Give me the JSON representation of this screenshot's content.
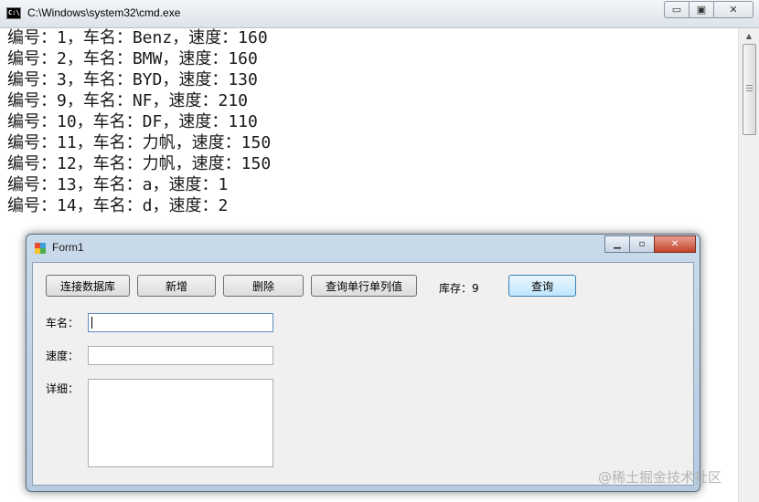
{
  "cmd": {
    "title": "C:\\Windows\\system32\\cmd.exe",
    "icon_text": "C:\\",
    "lines": [
      "编号：1，车名：Benz，速度：160",
      "编号：2，车名：BMW，速度：160",
      "编号：3，车名：BYD，速度：130",
      "编号：9，车名：NF，速度：210",
      "编号：10，车名：DF，速度：110",
      "编号：11，车名：力帆，速度：150",
      "编号：12，车名：力帆，速度：150",
      "编号：13，车名：a，速度：1",
      "编号：14，车名：d，速度：2"
    ],
    "controls": {
      "minimize": "▭",
      "maximize": "▣",
      "close": "✕"
    }
  },
  "form": {
    "title": "Form1",
    "controls": {
      "minimize": "▁",
      "maximize": "▫",
      "close": "✕"
    },
    "buttons": {
      "connect": "连接数据库",
      "add": "新增",
      "delete": "删除",
      "query_single": "查询单行单列值",
      "query": "查询"
    },
    "stock_label": "库存：9",
    "labels": {
      "name": "车名：",
      "speed": "速度：",
      "detail": "详细："
    },
    "fields": {
      "name_value": "",
      "speed_value": "",
      "detail_value": ""
    }
  },
  "watermark": "@稀土掘金技术社区"
}
